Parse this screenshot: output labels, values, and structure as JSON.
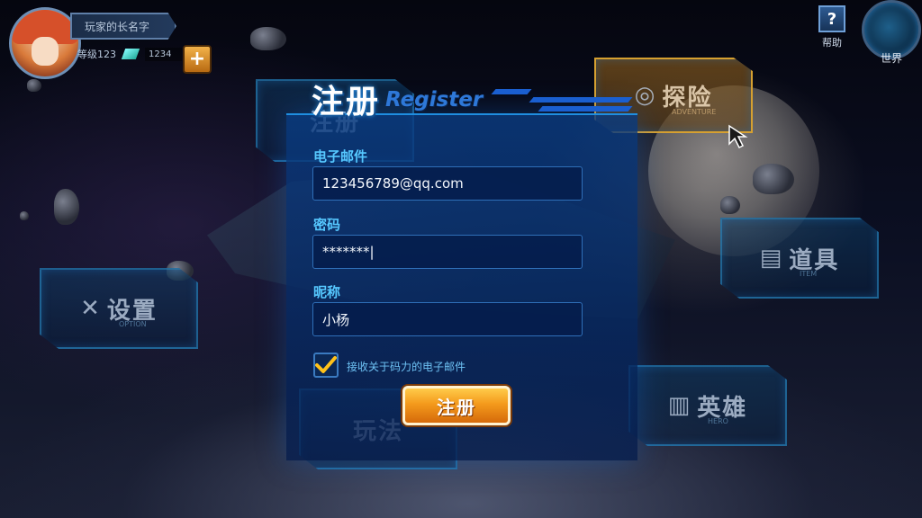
{
  "hud": {
    "player_name": "玩家的长名字",
    "level_text": "等级123",
    "gems": "1234",
    "add_label": "+",
    "help_label": "帮助",
    "help_icon": "?",
    "world_label": "世界"
  },
  "menu": {
    "adventure": {
      "label": "探险",
      "sub": "ADVENTURE",
      "icon": "target-icon"
    },
    "items": {
      "label": "道具",
      "sub": "ITEM",
      "icon": "chest-icon"
    },
    "hero": {
      "label": "英雄",
      "sub": "HERO",
      "icon": "helmet-icon"
    },
    "option": {
      "label": "设置",
      "sub": "OPTION",
      "icon": "wrench-icon"
    },
    "top_hidden": {
      "label": "注册",
      "sub": ""
    },
    "bottom_hidden": {
      "label": "玩法",
      "sub": ""
    }
  },
  "register": {
    "title_cn": "注册",
    "title_en": "Register",
    "email_label": "电子邮件",
    "email_value": "123456789@qq.com",
    "password_label": "密码",
    "password_value": "*******|",
    "nickname_label": "昵称",
    "nickname_value": "小杨",
    "newsletter_label": "接收关于码力的电子邮件",
    "newsletter_checked": true,
    "submit_label": "注册"
  },
  "colors": {
    "accent": "#1f8ee0",
    "button": "#f49a1c",
    "label": "#56c8ff"
  }
}
